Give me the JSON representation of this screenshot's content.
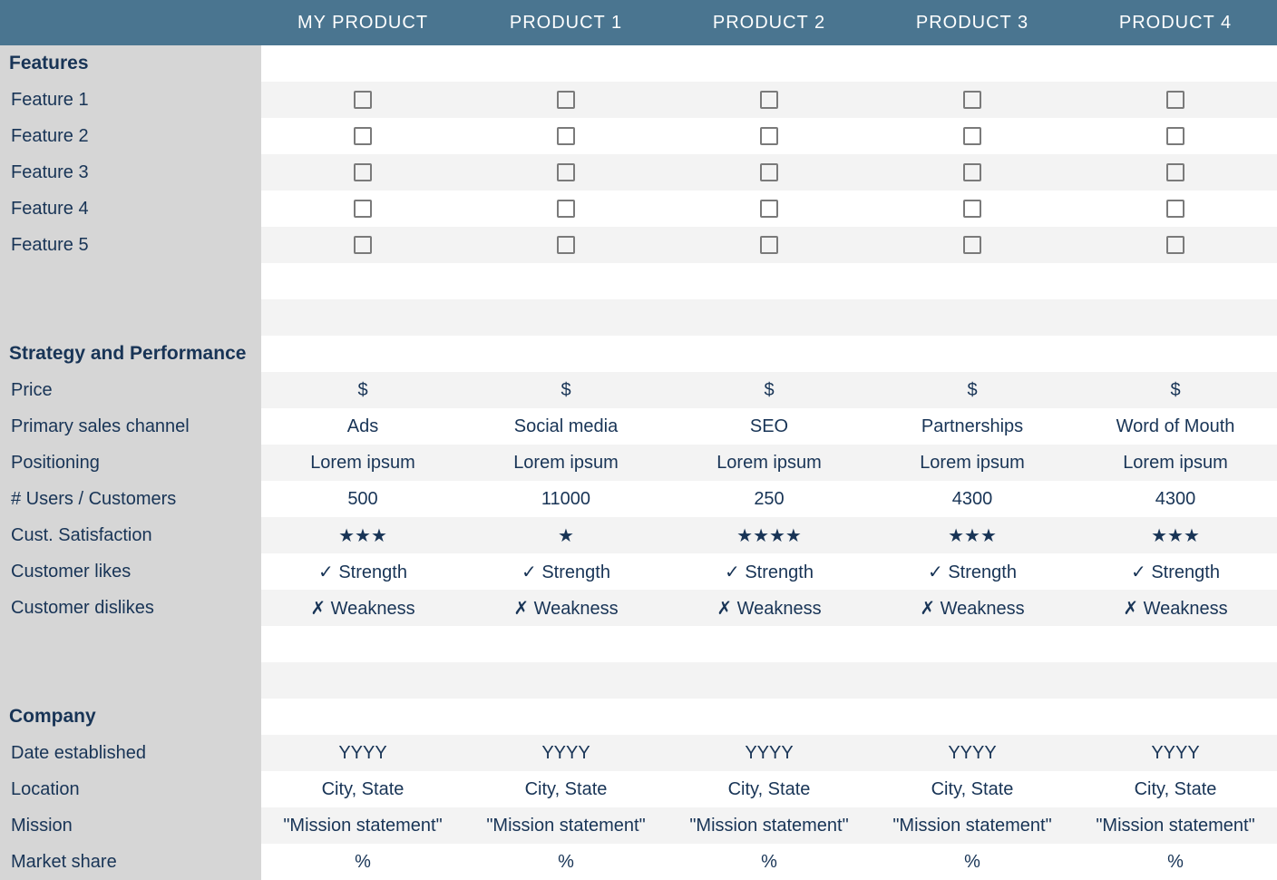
{
  "columns": [
    "MY PRODUCT",
    "PRODUCT 1",
    "PRODUCT 2",
    "PRODUCT 3",
    "PRODUCT 4"
  ],
  "sections": {
    "features": {
      "title": "Features",
      "rows": [
        {
          "label": "Feature 1",
          "cells": [
            "checkbox",
            "checkbox",
            "checkbox",
            "checkbox",
            "checkbox"
          ]
        },
        {
          "label": "Feature 2",
          "cells": [
            "checkbox",
            "checkbox",
            "checkbox",
            "checkbox",
            "checkbox"
          ]
        },
        {
          "label": "Feature 3",
          "cells": [
            "checkbox",
            "checkbox",
            "checkbox",
            "checkbox",
            "checkbox"
          ]
        },
        {
          "label": "Feature 4",
          "cells": [
            "checkbox",
            "checkbox",
            "checkbox",
            "checkbox",
            "checkbox"
          ]
        },
        {
          "label": "Feature 5",
          "cells": [
            "checkbox",
            "checkbox",
            "checkbox",
            "checkbox",
            "checkbox"
          ]
        }
      ]
    },
    "strategy": {
      "title": "Strategy and Performance",
      "rows": [
        {
          "label": "Price",
          "cells": [
            "$",
            "$",
            "$",
            "$",
            "$"
          ]
        },
        {
          "label": "Primary sales channel",
          "cells": [
            "Ads",
            "Social media",
            "SEO",
            "Partnerships",
            "Word of Mouth"
          ]
        },
        {
          "label": "Positioning",
          "cells": [
            "Lorem ipsum",
            "Lorem ipsum",
            "Lorem ipsum",
            "Lorem ipsum",
            "Lorem ipsum"
          ]
        },
        {
          "label": "# Users / Customers",
          "cells": [
            "500",
            "11000",
            "250",
            "4300",
            "4300"
          ]
        },
        {
          "label": "Cust. Satisfaction",
          "cells": [
            "★★★",
            "★",
            "★★★★",
            "★★★",
            "★★★"
          ]
        },
        {
          "label": "Customer likes",
          "cells": [
            "✓ Strength",
            "✓ Strength",
            "✓ Strength",
            "✓ Strength",
            "✓ Strength"
          ]
        },
        {
          "label": "Customer dislikes",
          "cells": [
            "✗ Weakness",
            "✗ Weakness",
            "✗ Weakness",
            "✗ Weakness",
            "✗ Weakness"
          ]
        }
      ]
    },
    "company": {
      "title": "Company",
      "rows": [
        {
          "label": "Date established",
          "cells": [
            "YYYY",
            "YYYY",
            "YYYY",
            "YYYY",
            "YYYY"
          ]
        },
        {
          "label": "Location",
          "cells": [
            "City, State",
            "City, State",
            "City, State",
            "City, State",
            "City, State"
          ]
        },
        {
          "label": "Mission",
          "cells": [
            "\"Mission statement\"",
            "\"Mission statement\"",
            "\"Mission statement\"",
            "\"Mission statement\"",
            "\"Mission statement\""
          ]
        },
        {
          "label": "Market share",
          "cells": [
            "%",
            "%",
            "%",
            "%",
            "%"
          ]
        }
      ]
    }
  },
  "chart_data": {
    "type": "table",
    "title": "Competitor / product comparison matrix",
    "columns": [
      "MY PRODUCT",
      "PRODUCT 1",
      "PRODUCT 2",
      "PRODUCT 3",
      "PRODUCT 4"
    ],
    "rows": [
      {
        "section": "Features",
        "label": "Feature 1",
        "values": [
          false,
          false,
          false,
          false,
          false
        ]
      },
      {
        "section": "Features",
        "label": "Feature 2",
        "values": [
          false,
          false,
          false,
          false,
          false
        ]
      },
      {
        "section": "Features",
        "label": "Feature 3",
        "values": [
          false,
          false,
          false,
          false,
          false
        ]
      },
      {
        "section": "Features",
        "label": "Feature 4",
        "values": [
          false,
          false,
          false,
          false,
          false
        ]
      },
      {
        "section": "Features",
        "label": "Feature 5",
        "values": [
          false,
          false,
          false,
          false,
          false
        ]
      },
      {
        "section": "Strategy and Performance",
        "label": "Price",
        "values": [
          "$",
          "$",
          "$",
          "$",
          "$"
        ]
      },
      {
        "section": "Strategy and Performance",
        "label": "Primary sales channel",
        "values": [
          "Ads",
          "Social media",
          "SEO",
          "Partnerships",
          "Word of Mouth"
        ]
      },
      {
        "section": "Strategy and Performance",
        "label": "Positioning",
        "values": [
          "Lorem ipsum",
          "Lorem ipsum",
          "Lorem ipsum",
          "Lorem ipsum",
          "Lorem ipsum"
        ]
      },
      {
        "section": "Strategy and Performance",
        "label": "# Users / Customers",
        "values": [
          500,
          11000,
          250,
          4300,
          4300
        ]
      },
      {
        "section": "Strategy and Performance",
        "label": "Cust. Satisfaction",
        "values": [
          3,
          1,
          4,
          3,
          3
        ]
      },
      {
        "section": "Strategy and Performance",
        "label": "Customer likes",
        "values": [
          "✓ Strength",
          "✓ Strength",
          "✓ Strength",
          "✓ Strength",
          "✓ Strength"
        ]
      },
      {
        "section": "Strategy and Performance",
        "label": "Customer dislikes",
        "values": [
          "✗ Weakness",
          "✗ Weakness",
          "✗ Weakness",
          "✗ Weakness",
          "✗ Weakness"
        ]
      },
      {
        "section": "Company",
        "label": "Date established",
        "values": [
          "YYYY",
          "YYYY",
          "YYYY",
          "YYYY",
          "YYYY"
        ]
      },
      {
        "section": "Company",
        "label": "Location",
        "values": [
          "City, State",
          "City, State",
          "City, State",
          "City, State",
          "City, State"
        ]
      },
      {
        "section": "Company",
        "label": "Mission",
        "values": [
          "\"Mission statement\"",
          "\"Mission statement\"",
          "\"Mission statement\"",
          "\"Mission statement\"",
          "\"Mission statement\""
        ]
      },
      {
        "section": "Company",
        "label": "Market share",
        "values": [
          "%",
          "%",
          "%",
          "%",
          "%"
        ]
      }
    ]
  }
}
